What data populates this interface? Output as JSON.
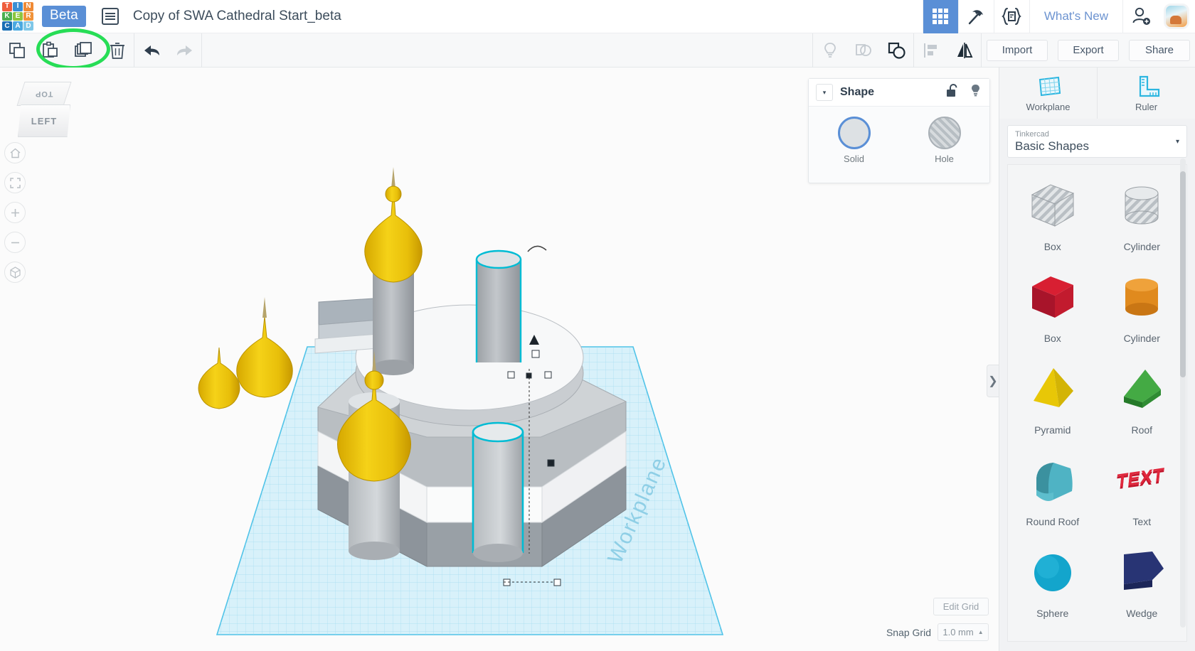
{
  "app": {
    "logo_letters": [
      "T",
      "I",
      "N",
      "K",
      "E",
      "R",
      "C",
      "A",
      "D"
    ],
    "logo_colors": [
      "#ef5d3d",
      "#3a8ed4",
      "#f08a35",
      "#4cae4f",
      "#8cc63f",
      "#f0933a",
      "#1a6fb5",
      "#4aa9e0",
      "#7fc7e8"
    ],
    "beta_badge": "Beta",
    "doc_title": "Copy of SWA Cathedral Start_beta",
    "whats_new": "What's New",
    "icons": {
      "document_list": "document-list-icon",
      "grid_apps": "grid-apps-icon",
      "pickaxe": "pickaxe-icon",
      "codeblocks": "codeblocks-icon",
      "invite_user": "user-add-icon",
      "avatar": "avatar-thumbnail"
    }
  },
  "toolbar": {
    "left_tools": [
      {
        "name": "copy-icon",
        "label": "Copy"
      },
      {
        "name": "paste-icon",
        "label": "Paste"
      },
      {
        "name": "duplicate-icon",
        "label": "Duplicate"
      },
      {
        "name": "delete-icon",
        "label": "Delete"
      }
    ],
    "history_tools": [
      {
        "name": "undo-icon",
        "label": "Undo",
        "enabled": true
      },
      {
        "name": "redo-icon",
        "label": "Redo",
        "enabled": false
      }
    ],
    "right_tools": [
      {
        "name": "lightbulb-icon",
        "label": "Hint",
        "enabled": false
      },
      {
        "name": "group-icon",
        "label": "Group",
        "enabled": false
      },
      {
        "name": "ungroup-icon",
        "label": "Ungroup",
        "enabled": true
      },
      {
        "name": "align-icon",
        "label": "Align",
        "enabled": false
      },
      {
        "name": "mirror-icon",
        "label": "Mirror",
        "enabled": true
      }
    ],
    "import_label": "Import",
    "export_label": "Export",
    "share_label": "Share"
  },
  "highlight": {
    "shape": "green-ellipse",
    "color": "#27dd56"
  },
  "canvas": {
    "viewcube": {
      "top_face": "TOP",
      "front_face": "LEFT"
    },
    "nav_buttons": [
      {
        "name": "home-view-icon",
        "glyph": "⌂"
      },
      {
        "name": "fit-view-icon",
        "glyph": "⬚"
      },
      {
        "name": "zoom-in-icon",
        "glyph": "+"
      },
      {
        "name": "zoom-out-icon",
        "glyph": "−"
      },
      {
        "name": "ortho-perspective-icon",
        "glyph": "⬡"
      }
    ],
    "workplane_label": "Workplane",
    "edit_grid_label": "Edit Grid",
    "snap_grid_label": "Snap Grid",
    "snap_grid_value": "1.0 mm",
    "collapse_glyph": "❯"
  },
  "shape_panel": {
    "title": "Shape",
    "caret": "▾",
    "lock_icon": "unlock-icon",
    "bulb_icon": "lightbulb-icon",
    "options": [
      {
        "name": "solid-option",
        "label": "Solid",
        "selected": true
      },
      {
        "name": "hole-option",
        "label": "Hole",
        "selected": false
      }
    ]
  },
  "sidebar": {
    "tools": [
      {
        "name": "workplane-tool",
        "label": "Workplane"
      },
      {
        "name": "ruler-tool",
        "label": "Ruler"
      }
    ],
    "library": {
      "owner": "Tinkercad",
      "collection": "Basic Shapes",
      "caret": "▾"
    },
    "shapes": [
      {
        "name": "Box",
        "style": "hatched-box"
      },
      {
        "name": "Cylinder",
        "style": "hatched-cylinder"
      },
      {
        "name": "Box",
        "style": "red-box"
      },
      {
        "name": "Cylinder",
        "style": "orange-cylinder"
      },
      {
        "name": "Pyramid",
        "style": "yellow-pyramid"
      },
      {
        "name": "Roof",
        "style": "green-roof"
      },
      {
        "name": "Round Roof",
        "style": "teal-round-roof"
      },
      {
        "name": "Text",
        "style": "red-text"
      },
      {
        "name": "Sphere",
        "style": "cyan-sphere"
      },
      {
        "name": "Wedge",
        "style": "blue-wedge"
      }
    ]
  }
}
